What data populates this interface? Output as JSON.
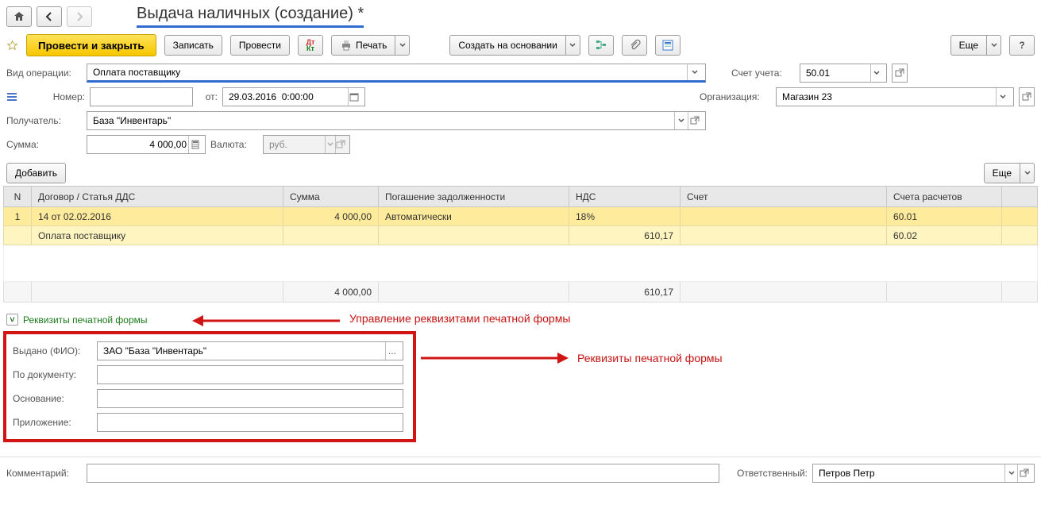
{
  "header": {
    "title": "Выдача наличных (создание) *"
  },
  "toolbar": {
    "submit_close": "Провести и закрыть",
    "save": "Записать",
    "post": "Провести",
    "print": "Печать",
    "create_based": "Создать на основании",
    "more": "Еще"
  },
  "fields": {
    "op_type_label": "Вид операции:",
    "op_type_value": "Оплата поставщику",
    "account_label": "Счет учета:",
    "account_value": "50.01",
    "number_label": "Номер:",
    "number_value": "",
    "date_from_label": "от:",
    "date_value": "29.03.2016  0:00:00",
    "org_label": "Организация:",
    "org_value": "Магазин 23",
    "payee_label": "Получатель:",
    "payee_value": "База \"Инвентарь\"",
    "sum_label": "Сумма:",
    "sum_value": "4 000,00",
    "currency_label": "Валюта:",
    "currency_value": "руб.",
    "add_btn": "Добавить",
    "more2": "Еще"
  },
  "table": {
    "cols": {
      "n": "N",
      "contract": "Договор / Статья ДДС",
      "sum": "Сумма",
      "repay": "Погашение задолженности",
      "vat": "НДС",
      "acc": "Счет",
      "settle": "Счета расчетов"
    },
    "r1": {
      "n": "1",
      "contract": "14 от 02.02.2016",
      "sum": "4 000,00",
      "repay": "Автоматически",
      "vat": "18%",
      "acc": "",
      "settle": "60.01"
    },
    "r2": {
      "contract": "Оплата поставщику",
      "vat": "610,17",
      "settle": "60.02"
    },
    "totals": {
      "sum": "4 000,00",
      "vat": "610,17"
    }
  },
  "print_form": {
    "group_title": "Реквизиты печатной формы",
    "issued_label": "Выдано (ФИО):",
    "issued_value": "ЗАО \"База \"Инвентарь\"",
    "doc_label": "По документу:",
    "doc_value": "",
    "basis_label": "Основание:",
    "basis_value": "",
    "annex_label": "Приложение:",
    "annex_value": ""
  },
  "footer": {
    "comment_label": "Комментарий:",
    "comment_value": "",
    "resp_label": "Ответственный:",
    "resp_value": "Петров Петр"
  },
  "annotations": {
    "a1": "Управление реквизитами печатной формы",
    "a2": "Реквизиты печатной формы"
  }
}
